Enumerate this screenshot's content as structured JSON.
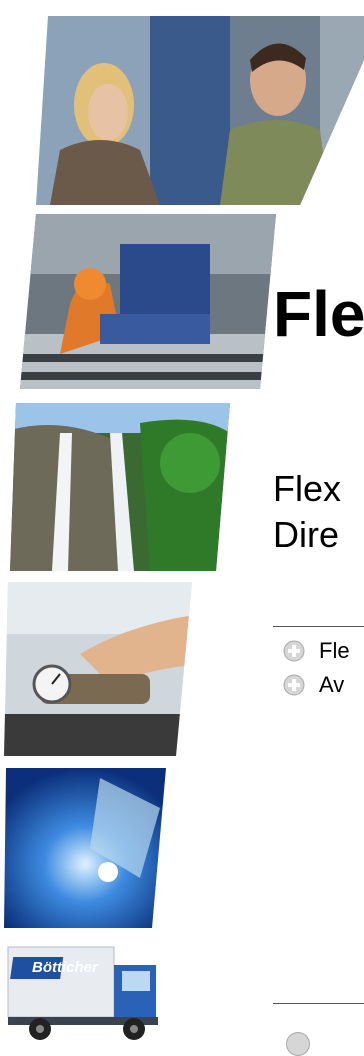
{
  "title": "Fle",
  "subtitle": {
    "line1": "Flex",
    "line2": "Dire"
  },
  "bullets": [
    {
      "icon": "plus-circle-icon",
      "text": "Fle"
    },
    {
      "icon": "plus-circle-icon",
      "text": "Av"
    }
  ],
  "logo": {
    "text": "Bötticher"
  },
  "colors": {
    "bullet_icon": "#bdbdbd",
    "rule": "#555555"
  }
}
